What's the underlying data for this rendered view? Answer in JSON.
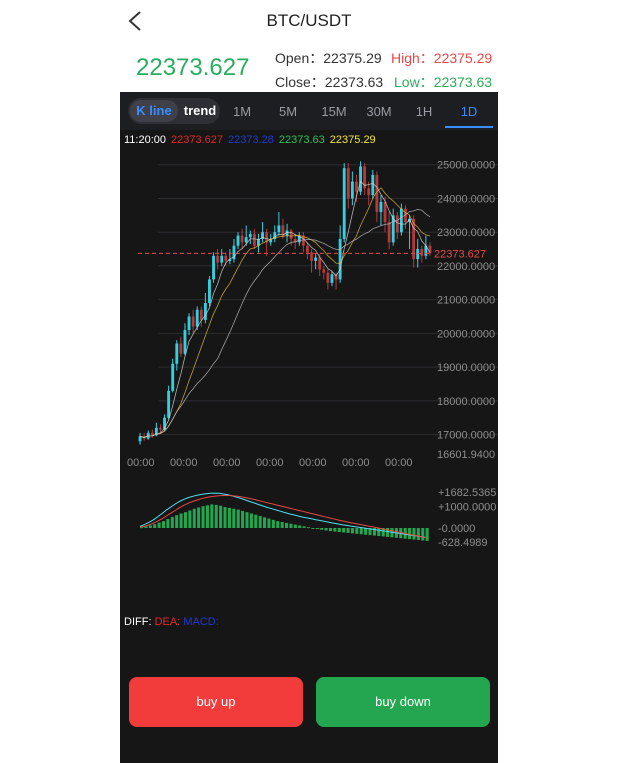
{
  "header": {
    "title": "BTC/USDT"
  },
  "ticker": {
    "price": "22373.627",
    "open_label": "Open：",
    "open": "22375.29",
    "high_label": "High：",
    "high": "22375.29",
    "close_label": "Close：",
    "close": "22373.63",
    "low_label": "Low：",
    "low": "22373.63"
  },
  "tabs": {
    "kline": "K line",
    "trend": "trend",
    "intervals": [
      "1M",
      "5M",
      "15M",
      "30M",
      "1H",
      "1D"
    ],
    "active": "1D"
  },
  "legend": {
    "time": "11:20:00",
    "ma1": "22373.627",
    "ma2": "22373.28",
    "ma3": "22373.63",
    "ma4": "22375.29"
  },
  "chart_data": {
    "type": "candlestick",
    "y_ticks": [
      "25000.0000",
      "24000.0000",
      "23000.0000",
      "22000.0000",
      "21000.0000",
      "20000.0000",
      "19000.0000",
      "18000.0000",
      "17000.0000"
    ],
    "y_min_label": "16601.9400",
    "ylim": [
      16601.94,
      25200
    ],
    "current_price": 22373.627,
    "current_label": "22373.627",
    "x_ticks": [
      "00:00",
      "00:00",
      "00:00",
      "00:00",
      "00:00",
      "00:00",
      "00:00"
    ],
    "candles": [
      [
        16801,
        16950,
        16700,
        17050
      ],
      [
        16950,
        16880,
        16820,
        17050
      ],
      [
        16880,
        17050,
        16850,
        17120
      ],
      [
        17050,
        16980,
        16900,
        17150
      ],
      [
        16980,
        17200,
        16950,
        17350
      ],
      [
        17200,
        17150,
        17050,
        17300
      ],
      [
        17150,
        17500,
        17100,
        17600
      ],
      [
        17500,
        18300,
        17450,
        18450
      ],
      [
        18300,
        19100,
        18250,
        19250
      ],
      [
        19100,
        19700,
        18900,
        19800
      ],
      [
        19700,
        19400,
        19300,
        19900
      ],
      [
        19400,
        20100,
        19350,
        20300
      ],
      [
        20100,
        20500,
        19950,
        20600
      ],
      [
        20500,
        20200,
        20000,
        20700
      ],
      [
        20200,
        20700,
        20100,
        20800
      ],
      [
        20700,
        20400,
        20200,
        20800
      ],
      [
        20400,
        20900,
        20300,
        21200
      ],
      [
        20900,
        21600,
        20800,
        21700
      ],
      [
        21600,
        22300,
        21500,
        22400
      ],
      [
        22300,
        22100,
        21900,
        22500
      ],
      [
        22100,
        22300,
        22000,
        22500
      ],
      [
        22300,
        22150,
        22000,
        22400
      ],
      [
        22150,
        22200,
        22050,
        22500
      ],
      [
        22200,
        22600,
        22100,
        22800
      ],
      [
        22600,
        22900,
        22500,
        23000
      ],
      [
        22900,
        22700,
        22500,
        23100
      ],
      [
        22700,
        22850,
        22600,
        23200
      ],
      [
        22850,
        22950,
        22650,
        23050
      ],
      [
        22950,
        22600,
        22500,
        23100
      ],
      [
        22600,
        22800,
        22400,
        22950
      ],
      [
        22800,
        23000,
        22700,
        23300
      ],
      [
        23000,
        22700,
        22300,
        23100
      ],
      [
        22700,
        22800,
        22600,
        22950
      ],
      [
        22800,
        23000,
        22700,
        23200
      ],
      [
        23000,
        23200,
        22900,
        23600
      ],
      [
        23200,
        22900,
        22800,
        23400
      ],
      [
        22900,
        23050,
        22700,
        23250
      ],
      [
        23050,
        22800,
        22600,
        23100
      ],
      [
        22800,
        22700,
        22500,
        22950
      ],
      [
        22700,
        22900,
        22600,
        23000
      ],
      [
        22900,
        22600,
        22400,
        23000
      ],
      [
        22600,
        22400,
        22200,
        22700
      ],
      [
        22400,
        22150,
        21800,
        22500
      ],
      [
        22150,
        22250,
        21900,
        22350
      ],
      [
        22250,
        21900,
        21700,
        22350
      ],
      [
        21900,
        21800,
        21600,
        22000
      ],
      [
        21800,
        21500,
        21300,
        21900
      ],
      [
        21500,
        21750,
        21400,
        21850
      ],
      [
        21750,
        21600,
        21300,
        21800
      ],
      [
        21600,
        22800,
        21500,
        23200
      ],
      [
        22800,
        24900,
        22700,
        25050
      ],
      [
        24900,
        24000,
        23700,
        25050
      ],
      [
        24000,
        24500,
        23800,
        24800
      ],
      [
        24500,
        24200,
        23900,
        24700
      ],
      [
        24200,
        24950,
        24100,
        25100
      ],
      [
        24950,
        24300,
        24100,
        25050
      ],
      [
        24300,
        24100,
        23800,
        24500
      ],
      [
        24100,
        24700,
        24000,
        24850
      ],
      [
        24700,
        23600,
        23300,
        24800
      ],
      [
        23600,
        23900,
        23200,
        24100
      ],
      [
        23900,
        23300,
        23000,
        24050
      ],
      [
        23300,
        22700,
        22500,
        23600
      ],
      [
        22700,
        23500,
        22600,
        23700
      ],
      [
        23500,
        23000,
        22800,
        23600
      ],
      [
        23000,
        23700,
        22900,
        23850
      ],
      [
        23700,
        23300,
        23100,
        23800
      ],
      [
        23300,
        23400,
        22500,
        23500
      ],
      [
        23400,
        22200,
        21950,
        23500
      ],
      [
        22200,
        22500,
        21950,
        22800
      ],
      [
        22500,
        22300,
        22100,
        22600
      ],
      [
        22300,
        22600,
        22200,
        22900
      ],
      [
        22600,
        22373,
        22300,
        22700
      ]
    ],
    "macd_labels": {
      "top": "+1682.5365",
      "mid": "+1000.0000",
      "zero": "-0.0000",
      "bottom": "-628.4989"
    },
    "macd_hist": [
      40,
      80,
      120,
      180,
      250,
      320,
      420,
      520,
      600,
      680,
      740,
      820,
      900,
      960,
      1020,
      1060,
      1100,
      1080,
      1040,
      980,
      940,
      900,
      860,
      800,
      740,
      680,
      620,
      560,
      500,
      440,
      380,
      320,
      280,
      240,
      200,
      160,
      120,
      80,
      40,
      0,
      -40,
      -80,
      -110,
      -140,
      -160,
      -180,
      -200,
      -220,
      -240,
      -260,
      -280,
      -300,
      -320,
      -340,
      -360,
      -380,
      -400,
      -420,
      -440,
      -460,
      -480,
      -500,
      -520,
      -540,
      -560,
      -580
    ],
    "macd_diff": [
      80,
      160,
      260,
      380,
      520,
      680,
      840,
      980,
      1120,
      1240,
      1340,
      1420,
      1480,
      1530,
      1570,
      1600,
      1620,
      1630,
      1620,
      1590,
      1550,
      1500,
      1440,
      1380,
      1310,
      1240,
      1170,
      1100,
      1030,
      960,
      900,
      840,
      780,
      720,
      660,
      610,
      560,
      510,
      470,
      430,
      390,
      350,
      310,
      270,
      230,
      190,
      150,
      120,
      90,
      60,
      30,
      0,
      -30,
      -60,
      -90,
      -120,
      -150,
      -180,
      -210,
      -240,
      -270,
      -300,
      -330,
      -360,
      -390,
      -420
    ],
    "macd_dea": [
      40,
      80,
      140,
      220,
      320,
      430,
      560,
      690,
      820,
      950,
      1060,
      1160,
      1240,
      1310,
      1370,
      1420,
      1460,
      1490,
      1510,
      1520,
      1520,
      1510,
      1490,
      1460,
      1420,
      1380,
      1330,
      1280,
      1230,
      1180,
      1130,
      1080,
      1030,
      980,
      930,
      880,
      830,
      780,
      730,
      680,
      630,
      580,
      530,
      480,
      430,
      380,
      330,
      290,
      250,
      210,
      170,
      130,
      90,
      50,
      10,
      -30,
      -70,
      -110,
      -150,
      -190,
      -230,
      -270,
      -310,
      -350,
      -390,
      -430
    ]
  },
  "macd_legend": {
    "diff": "DIFF:",
    "dea": "DEA:",
    "macd": "MACD:"
  },
  "actions": {
    "buy_up": "buy up",
    "buy_down": "buy down"
  },
  "colors": {
    "up": "#f23c3c",
    "down": "#24a650",
    "accent": "#3a8dff",
    "candle_up": "#35cfe0",
    "candle_down": "#b33a3a",
    "price_green": "#27ae5f"
  }
}
